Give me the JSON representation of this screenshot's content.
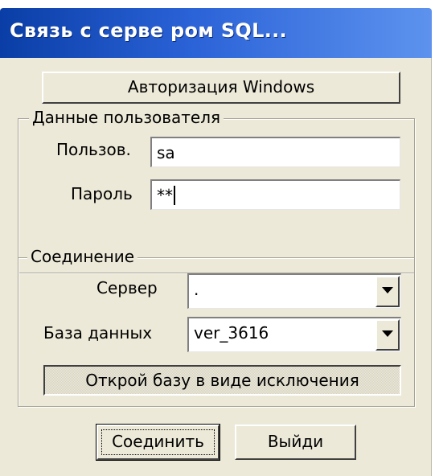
{
  "window": {
    "title": "Связь с серве ром SQL..."
  },
  "buttons": {
    "windows_auth": "Авторизация Windows",
    "exclusive": "Открой базу в виде исключения",
    "connect": "Соединить",
    "exit": "Выйди"
  },
  "user_group": {
    "legend": "Данные пользователя",
    "user_label": "Пользов.",
    "user_value": "sa",
    "password_label": "Пароль",
    "password_value": "**"
  },
  "connection_group": {
    "legend": "Соединение",
    "server_label": "Сервер",
    "server_value": ".",
    "database_label": "База данных",
    "database_value": "ver_3616"
  },
  "icons": {
    "dropdown": "chevron-down-icon"
  }
}
